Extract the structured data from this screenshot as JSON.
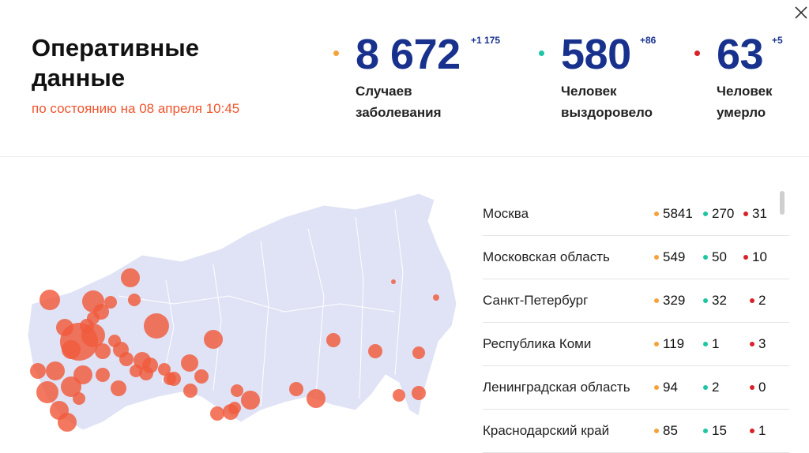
{
  "header": {
    "title_line1": "Оперативные",
    "title_line2": "данные",
    "subtitle": "по состоянию на 08 апреля 10:45"
  },
  "stats": [
    {
      "id": "cases",
      "value": "8 672",
      "delta": "+1 175",
      "label_line1": "Случаев",
      "label_line2": "заболевания",
      "color": "#f6a23a"
    },
    {
      "id": "recovered",
      "value": "580",
      "delta": "+86",
      "label_line1": "Человек",
      "label_line2": "выздоровело",
      "color": "#1ec5a5"
    },
    {
      "id": "deaths",
      "value": "63",
      "delta": "+5",
      "label_line1": "Человек",
      "label_line2": "умерло",
      "color": "#d7222b"
    }
  ],
  "colors": {
    "accent": "#f0542d",
    "number": "#18318d",
    "map_fill": "#dfe3f5",
    "bubble": "#f05a3c"
  },
  "icons": {
    "close": "close-icon"
  },
  "regions": [
    {
      "name": "Москва",
      "cases": "5841",
      "recovered": "270",
      "deaths": "31"
    },
    {
      "name": "Московская область",
      "cases": "549",
      "recovered": "50",
      "deaths": "10"
    },
    {
      "name": "Санкт-Петербург",
      "cases": "329",
      "recovered": "32",
      "deaths": "2"
    },
    {
      "name": "Республика Коми",
      "cases": "119",
      "recovered": "1",
      "deaths": "3"
    },
    {
      "name": "Ленинградская область",
      "cases": "94",
      "recovered": "2",
      "deaths": "0"
    },
    {
      "name": "Краснодарский край",
      "cases": "85",
      "recovered": "15",
      "deaths": "1"
    }
  ]
}
